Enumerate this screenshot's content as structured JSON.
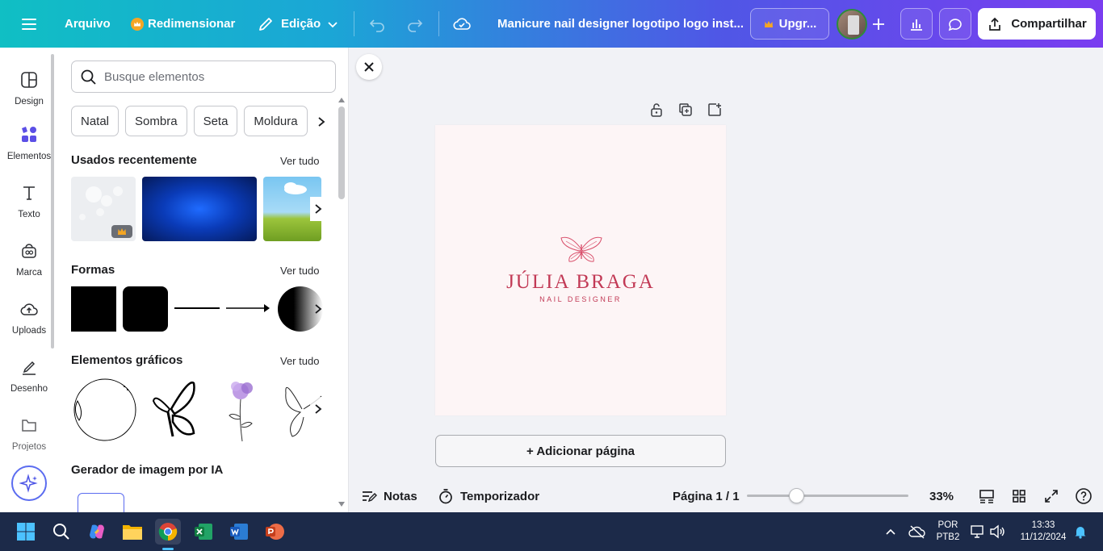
{
  "topbar": {
    "menu_icon": "hamburger-icon",
    "file_label": "Arquivo",
    "resize_label": "Redimensionar",
    "edit_label": "Edição",
    "doc_title": "Manicure nail designer logotipo logo inst...",
    "upgrade_label": "Upgr...",
    "share_label": "Compartilhar"
  },
  "rail": {
    "items": [
      {
        "label": "Design",
        "icon": "design-icon"
      },
      {
        "label": "Elementos",
        "icon": "elements-icon"
      },
      {
        "label": "Texto",
        "icon": "text-icon"
      },
      {
        "label": "Marca",
        "icon": "brand-icon"
      },
      {
        "label": "Uploads",
        "icon": "upload-icon"
      },
      {
        "label": "Desenho",
        "icon": "draw-icon"
      },
      {
        "label": "Projetos",
        "icon": "folder-icon"
      }
    ]
  },
  "panel": {
    "search_placeholder": "Busque elementos",
    "chips": [
      "Natal",
      "Sombra",
      "Seta",
      "Moldura"
    ],
    "recent_title": "Usados recentemente",
    "shapes_title": "Formas",
    "graphics_title": "Elementos gráficos",
    "ai_title": "Gerador de imagem por IA",
    "see_all": "Ver tudo"
  },
  "canvas": {
    "logo_name": "JÚLIA BRAGA",
    "logo_sub": "NAIL DESIGNER",
    "add_page_label": "+ Adicionar página"
  },
  "bottom": {
    "notes_label": "Notas",
    "timer_label": "Temporizador",
    "page_label": "Página 1 / 1",
    "zoom_label": "33%",
    "zoom_level": 0.33
  },
  "taskbar": {
    "lang_top": "POR",
    "lang_bottom": "PTB2",
    "time": "13:33",
    "date": "11/12/2024"
  },
  "colors": {
    "brand_gradient_start": "#10bfc4",
    "brand_gradient_end": "#7a3df0",
    "logo_color": "#c23a56",
    "crown_color": "#f5a623"
  }
}
